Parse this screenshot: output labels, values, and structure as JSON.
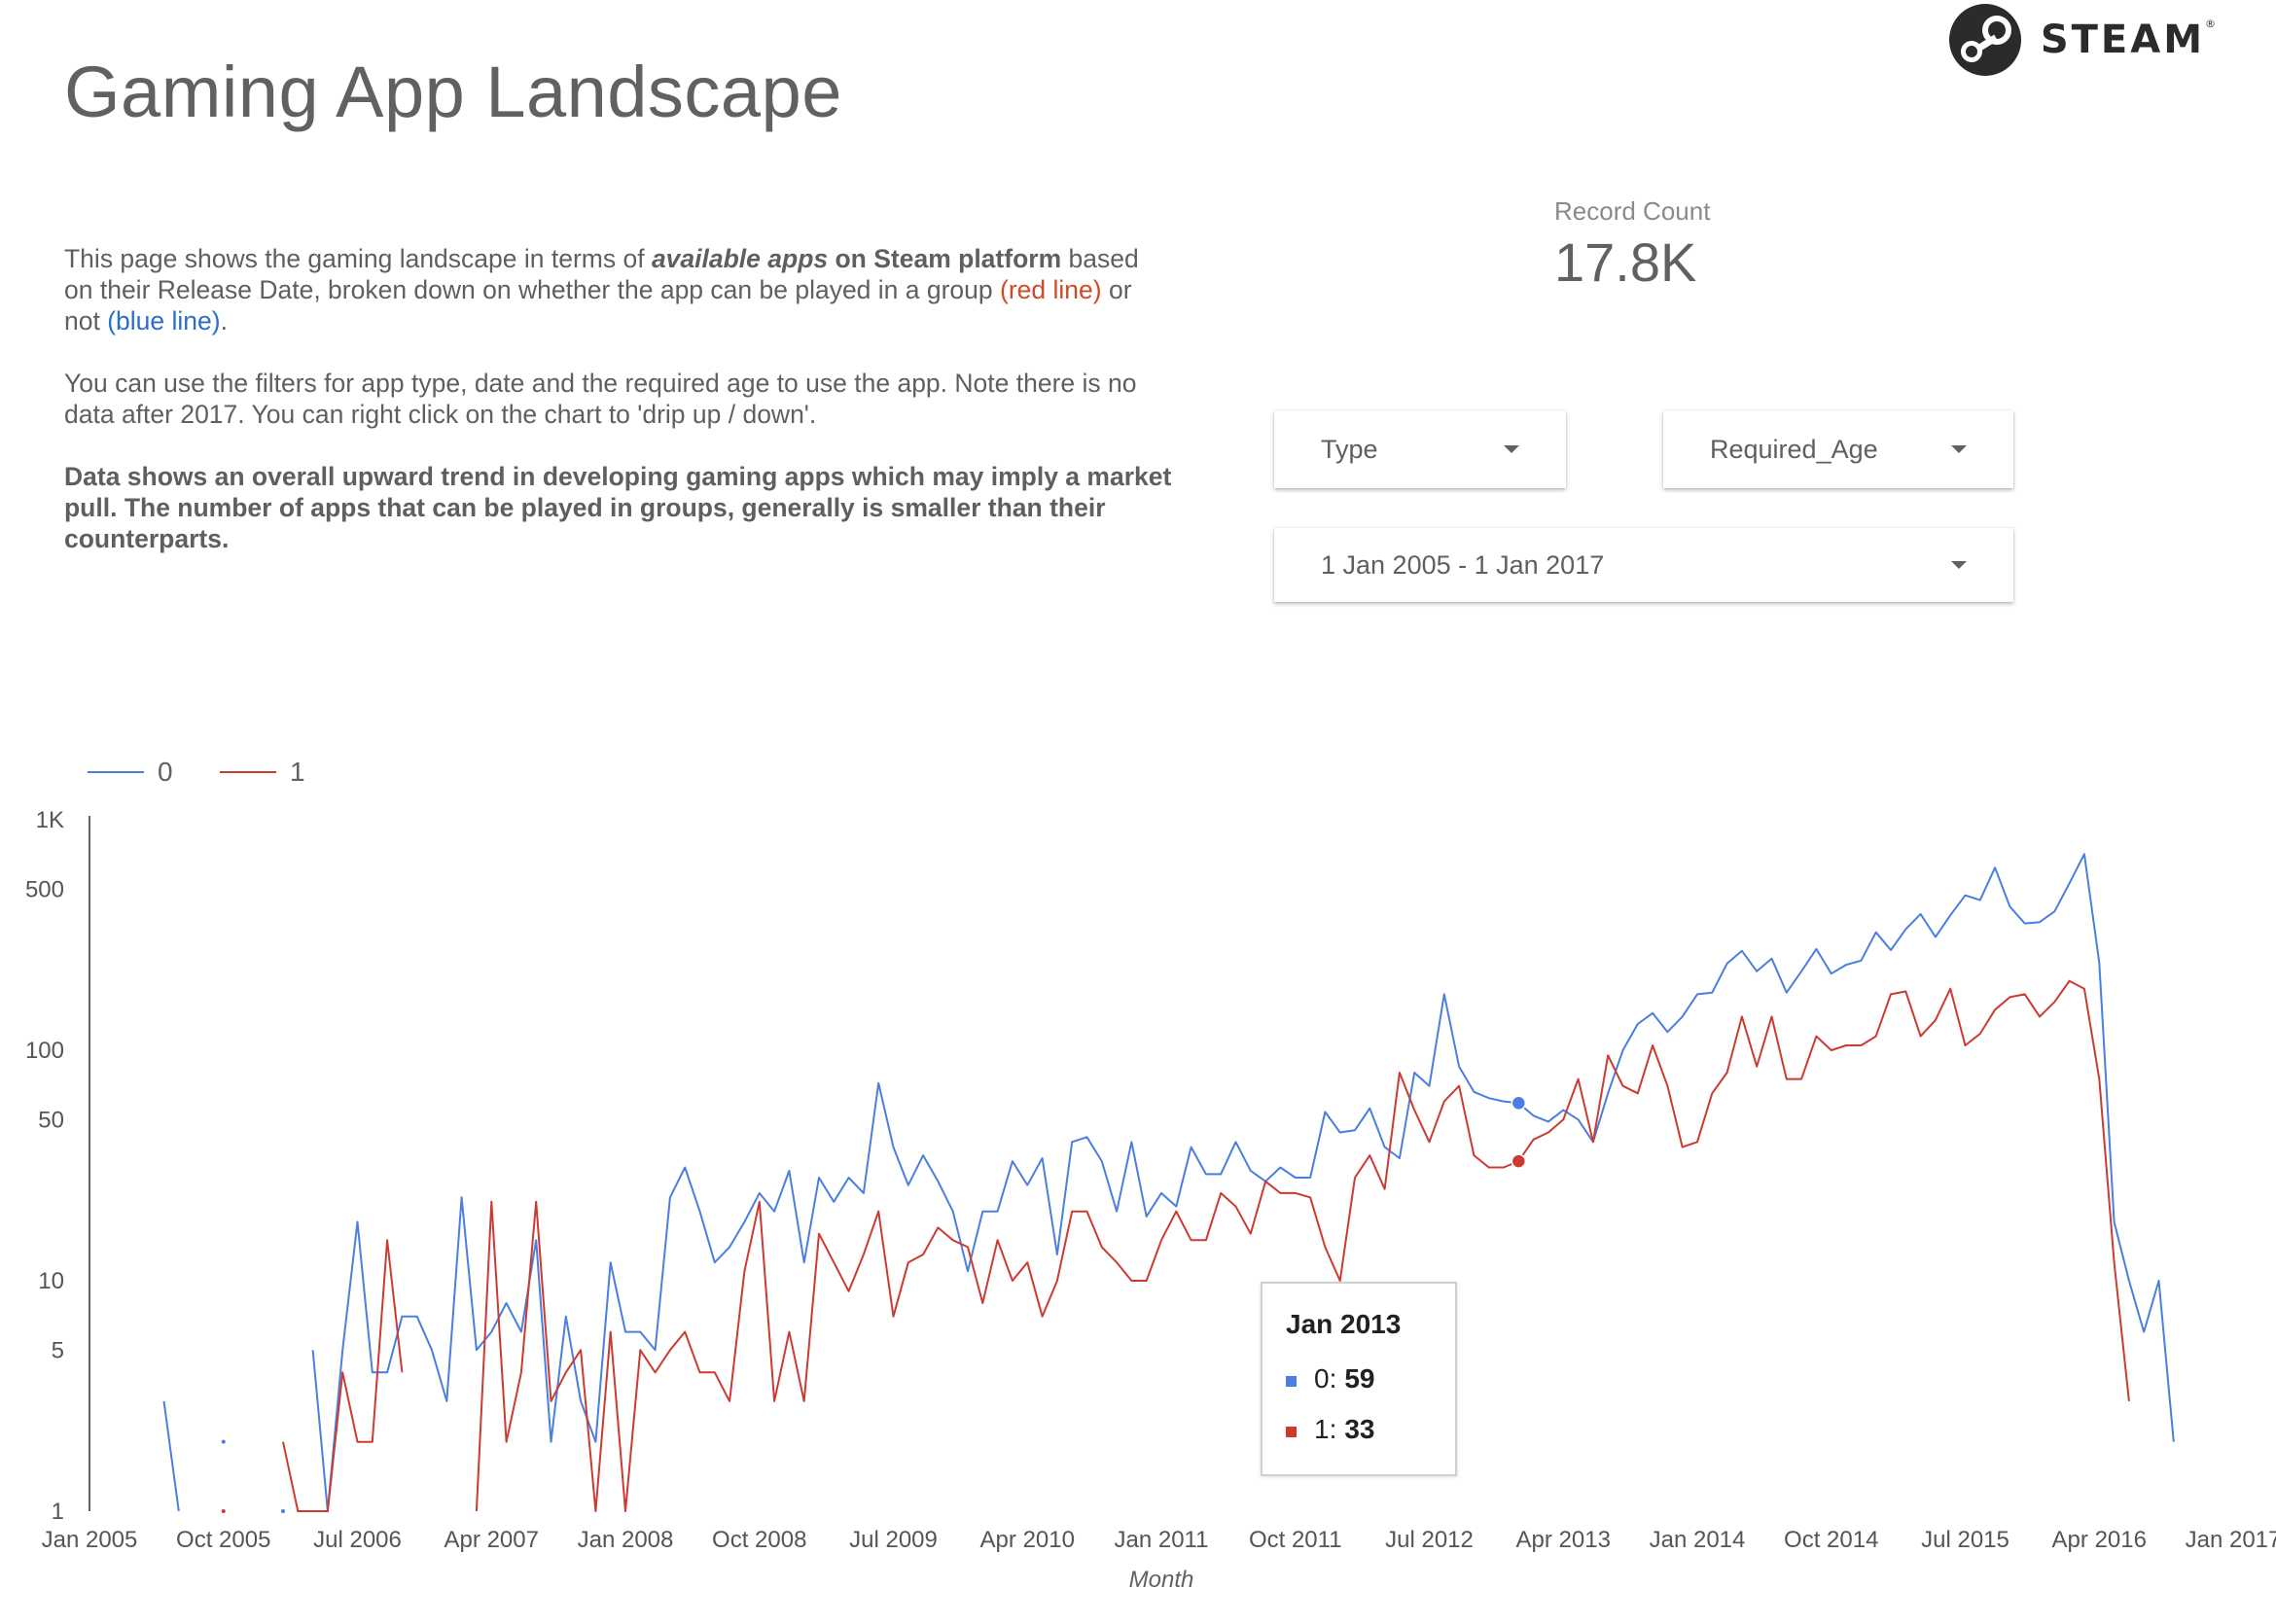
{
  "page": {
    "title": "Gaming App Landscape"
  },
  "logo": {
    "text": "STEAM",
    "mark": "®"
  },
  "description": {
    "p1": {
      "a": "This page shows the gaming landscape in terms of ",
      "b": "available apps",
      "c": " on Steam platform",
      "d": " based on their Release Date, broken down on whether the app can be played in a group ",
      "red": "(red line)",
      "e": " or not ",
      "blue": "(blue line)",
      "f": "."
    },
    "p2": "You can use the filters for app type, date and the required age to use the app. Note there is no data after 2017. You can right click on the chart to 'drip up / down'.",
    "p3": "Data shows an overall upward trend in developing gaming apps which may imply a market pull. The number of apps that can be played in groups, generally is smaller than their counterparts."
  },
  "scorecard": {
    "label": "Record Count",
    "value": "17.8K"
  },
  "filters": {
    "type": "Type",
    "required_age": "Required_Age",
    "date_range": "1 Jan 2005 - 1 Jan 2017"
  },
  "colors": {
    "series0": "#4a7ee0",
    "series1": "#cc3b32",
    "axis": "#616161",
    "text": "#616161"
  },
  "tooltip": {
    "title": "Jan 2013",
    "row0_label": "0:",
    "row0_value": "59",
    "row1_label": "1:",
    "row1_value": "33"
  },
  "chart_data": {
    "type": "line",
    "xlabel": "Month",
    "ylabel": "",
    "y_scale": "log",
    "ylim": [
      1,
      1000
    ],
    "y_ticks": [
      "1",
      "5",
      "10",
      "50",
      "100",
      "500",
      "1K"
    ],
    "y_tick_values": [
      1,
      5,
      10,
      50,
      100,
      500,
      1000
    ],
    "x_tick_labels": [
      "Jan 2005",
      "Oct 2005",
      "Jul 2006",
      "Apr 2007",
      "Jan 2008",
      "Oct 2008",
      "Jul 2009",
      "Apr 2010",
      "Jan 2011",
      "Oct 2011",
      "Jul 2012",
      "Apr 2013",
      "Jan 2014",
      "Oct 2014",
      "Jul 2015",
      "Apr 2016",
      "Jan 2017"
    ],
    "legend_position": "top-left",
    "grid": false,
    "highlight": {
      "x": "2013-01",
      "values": {
        "0": 59,
        "1": 33
      }
    },
    "series": [
      {
        "name": "0",
        "points": [
          [
            "2005-06",
            3
          ],
          [
            "2005-07",
            1
          ],
          [
            "2005-10",
            2
          ],
          [
            "2006-02",
            1
          ],
          [
            "2006-04",
            5
          ],
          [
            "2006-05",
            1
          ],
          [
            "2006-06",
            5
          ],
          [
            "2006-07",
            18
          ],
          [
            "2006-08",
            4
          ],
          [
            "2006-09",
            4
          ],
          [
            "2006-10",
            7
          ],
          [
            "2006-11",
            7
          ],
          [
            "2006-12",
            5
          ],
          [
            "2007-01",
            3
          ],
          [
            "2007-02",
            23
          ],
          [
            "2007-03",
            5
          ],
          [
            "2007-04",
            6
          ],
          [
            "2007-05",
            8
          ],
          [
            "2007-06",
            6
          ],
          [
            "2007-07",
            15
          ],
          [
            "2007-08",
            2
          ],
          [
            "2007-09",
            7
          ],
          [
            "2007-10",
            3
          ],
          [
            "2007-11",
            2
          ],
          [
            "2007-12",
            12
          ],
          [
            "2008-01",
            6
          ],
          [
            "2008-02",
            6
          ],
          [
            "2008-03",
            5
          ],
          [
            "2008-04",
            23
          ],
          [
            "2008-05",
            31
          ],
          [
            "2008-06",
            20
          ],
          [
            "2008-07",
            12
          ],
          [
            "2008-08",
            14
          ],
          [
            "2008-09",
            18
          ],
          [
            "2008-10",
            24
          ],
          [
            "2008-11",
            20
          ],
          [
            "2008-12",
            30
          ],
          [
            "2009-01",
            12
          ],
          [
            "2009-02",
            28
          ],
          [
            "2009-03",
            22
          ],
          [
            "2009-04",
            28
          ],
          [
            "2009-05",
            24
          ],
          [
            "2009-06",
            72
          ],
          [
            "2009-07",
            38
          ],
          [
            "2009-08",
            26
          ],
          [
            "2009-09",
            35
          ],
          [
            "2009-10",
            27
          ],
          [
            "2009-11",
            20
          ],
          [
            "2009-12",
            11
          ],
          [
            "2010-01",
            20
          ],
          [
            "2010-02",
            20
          ],
          [
            "2010-03",
            33
          ],
          [
            "2010-04",
            26
          ],
          [
            "2010-05",
            34
          ],
          [
            "2010-06",
            13
          ],
          [
            "2010-07",
            40
          ],
          [
            "2010-08",
            42
          ],
          [
            "2010-09",
            33
          ],
          [
            "2010-10",
            20
          ],
          [
            "2010-11",
            40
          ],
          [
            "2010-12",
            19
          ],
          [
            "2011-01",
            24
          ],
          [
            "2011-02",
            21
          ],
          [
            "2011-03",
            38
          ],
          [
            "2011-04",
            29
          ],
          [
            "2011-05",
            29
          ],
          [
            "2011-06",
            40
          ],
          [
            "2011-07",
            30
          ],
          [
            "2011-08",
            27
          ],
          [
            "2011-09",
            31
          ],
          [
            "2011-10",
            28
          ],
          [
            "2011-11",
            28
          ],
          [
            "2011-12",
            54
          ],
          [
            "2012-01",
            44
          ],
          [
            "2012-02",
            45
          ],
          [
            "2012-03",
            56
          ],
          [
            "2012-04",
            38
          ],
          [
            "2012-05",
            34
          ],
          [
            "2012-06",
            80
          ],
          [
            "2012-07",
            70
          ],
          [
            "2012-08",
            175
          ],
          [
            "2012-09",
            85
          ],
          [
            "2012-10",
            66
          ],
          [
            "2012-11",
            62
          ],
          [
            "2012-12",
            60
          ],
          [
            "2013-01",
            59
          ],
          [
            "2013-02",
            52
          ],
          [
            "2013-03",
            49
          ],
          [
            "2013-04",
            55
          ],
          [
            "2013-05",
            50
          ],
          [
            "2013-06",
            40
          ],
          [
            "2013-07",
            65
          ],
          [
            "2013-08",
            100
          ],
          [
            "2013-09",
            130
          ],
          [
            "2013-10",
            145
          ],
          [
            "2013-11",
            120
          ],
          [
            "2013-12",
            140
          ],
          [
            "2014-01",
            175
          ],
          [
            "2014-02",
            178
          ],
          [
            "2014-03",
            238
          ],
          [
            "2014-04",
            270
          ],
          [
            "2014-05",
            220
          ],
          [
            "2014-06",
            250
          ],
          [
            "2014-07",
            178
          ],
          [
            "2014-08",
            220
          ],
          [
            "2014-09",
            275
          ],
          [
            "2014-10",
            215
          ],
          [
            "2014-11",
            235
          ],
          [
            "2014-12",
            245
          ],
          [
            "2015-01",
            325
          ],
          [
            "2015-02",
            272
          ],
          [
            "2015-03",
            335
          ],
          [
            "2015-04",
            390
          ],
          [
            "2015-05",
            310
          ],
          [
            "2015-06",
            385
          ],
          [
            "2015-07",
            470
          ],
          [
            "2015-08",
            448
          ],
          [
            "2015-09",
            620
          ],
          [
            "2015-10",
            420
          ],
          [
            "2015-11",
            355
          ],
          [
            "2015-12",
            360
          ],
          [
            "2016-01",
            400
          ],
          [
            "2016-02",
            530
          ],
          [
            "2016-03",
            710
          ],
          [
            "2016-04",
            240
          ],
          [
            "2016-05",
            18
          ],
          [
            "2016-06",
            10
          ],
          [
            "2016-07",
            6
          ],
          [
            "2016-08",
            10
          ],
          [
            "2016-09",
            2
          ]
        ]
      },
      {
        "name": "1",
        "points": [
          [
            "2005-10",
            1
          ],
          [
            "2006-02",
            2
          ],
          [
            "2006-03",
            1
          ],
          [
            "2006-04",
            1
          ],
          [
            "2006-05",
            1
          ],
          [
            "2006-06",
            4
          ],
          [
            "2006-07",
            2
          ],
          [
            "2006-08",
            2
          ],
          [
            "2006-09",
            15
          ],
          [
            "2006-10",
            4
          ],
          [
            "2007-03",
            1
          ],
          [
            "2007-04",
            22
          ],
          [
            "2007-05",
            2
          ],
          [
            "2007-06",
            4
          ],
          [
            "2007-07",
            22
          ],
          [
            "2007-08",
            3
          ],
          [
            "2007-09",
            4
          ],
          [
            "2007-10",
            5
          ],
          [
            "2007-11",
            1
          ],
          [
            "2007-12",
            6
          ],
          [
            "2008-01",
            1
          ],
          [
            "2008-02",
            5
          ],
          [
            "2008-03",
            4
          ],
          [
            "2008-04",
            5
          ],
          [
            "2008-05",
            6
          ],
          [
            "2008-06",
            4
          ],
          [
            "2008-07",
            4
          ],
          [
            "2008-08",
            3
          ],
          [
            "2008-09",
            11
          ],
          [
            "2008-10",
            22
          ],
          [
            "2008-11",
            3
          ],
          [
            "2008-12",
            6
          ],
          [
            "2009-01",
            3
          ],
          [
            "2009-02",
            16
          ],
          [
            "2009-03",
            12
          ],
          [
            "2009-04",
            9
          ],
          [
            "2009-05",
            13
          ],
          [
            "2009-06",
            20
          ],
          [
            "2009-07",
            7
          ],
          [
            "2009-08",
            12
          ],
          [
            "2009-09",
            13
          ],
          [
            "2009-10",
            17
          ],
          [
            "2009-11",
            15
          ],
          [
            "2009-12",
            14
          ],
          [
            "2010-01",
            8
          ],
          [
            "2010-02",
            15
          ],
          [
            "2010-03",
            10
          ],
          [
            "2010-04",
            12
          ],
          [
            "2010-05",
            7
          ],
          [
            "2010-06",
            10
          ],
          [
            "2010-07",
            20
          ],
          [
            "2010-08",
            20
          ],
          [
            "2010-09",
            14
          ],
          [
            "2010-10",
            12
          ],
          [
            "2010-11",
            10
          ],
          [
            "2010-12",
            10
          ],
          [
            "2011-01",
            15
          ],
          [
            "2011-02",
            20
          ],
          [
            "2011-03",
            15
          ],
          [
            "2011-04",
            15
          ],
          [
            "2011-05",
            24
          ],
          [
            "2011-06",
            21
          ],
          [
            "2011-07",
            16
          ],
          [
            "2011-08",
            27
          ],
          [
            "2011-09",
            24
          ],
          [
            "2011-10",
            24
          ],
          [
            "2011-11",
            23
          ],
          [
            "2011-12",
            14
          ],
          [
            "2012-01",
            10
          ],
          [
            "2012-02",
            28
          ],
          [
            "2012-03",
            35
          ],
          [
            "2012-04",
            25
          ],
          [
            "2012-05",
            80
          ],
          [
            "2012-06",
            55
          ],
          [
            "2012-07",
            40
          ],
          [
            "2012-08",
            60
          ],
          [
            "2012-09",
            70
          ],
          [
            "2012-10",
            35
          ],
          [
            "2012-11",
            31
          ],
          [
            "2012-12",
            31
          ],
          [
            "2013-01",
            33
          ],
          [
            "2013-02",
            41
          ],
          [
            "2013-03",
            44
          ],
          [
            "2013-04",
            50
          ],
          [
            "2013-05",
            75
          ],
          [
            "2013-06",
            40
          ],
          [
            "2013-07",
            95
          ],
          [
            "2013-08",
            70
          ],
          [
            "2013-09",
            65
          ],
          [
            "2013-10",
            105
          ],
          [
            "2013-11",
            70
          ],
          [
            "2013-12",
            38
          ],
          [
            "2014-01",
            40
          ],
          [
            "2014-02",
            65
          ],
          [
            "2014-03",
            80
          ],
          [
            "2014-04",
            140
          ],
          [
            "2014-05",
            85
          ],
          [
            "2014-06",
            140
          ],
          [
            "2014-07",
            75
          ],
          [
            "2014-08",
            75
          ],
          [
            "2014-09",
            115
          ],
          [
            "2014-10",
            100
          ],
          [
            "2014-11",
            105
          ],
          [
            "2014-12",
            105
          ],
          [
            "2015-01",
            115
          ],
          [
            "2015-02",
            175
          ],
          [
            "2015-03",
            180
          ],
          [
            "2015-04",
            115
          ],
          [
            "2015-05",
            135
          ],
          [
            "2015-06",
            185
          ],
          [
            "2015-07",
            105
          ],
          [
            "2015-08",
            118
          ],
          [
            "2015-09",
            150
          ],
          [
            "2015-10",
            170
          ],
          [
            "2015-11",
            175
          ],
          [
            "2015-12",
            140
          ],
          [
            "2016-01",
            162
          ],
          [
            "2016-02",
            200
          ],
          [
            "2016-03",
            185
          ],
          [
            "2016-04",
            75
          ],
          [
            "2016-05",
            12
          ],
          [
            "2016-06",
            3
          ]
        ]
      }
    ]
  }
}
